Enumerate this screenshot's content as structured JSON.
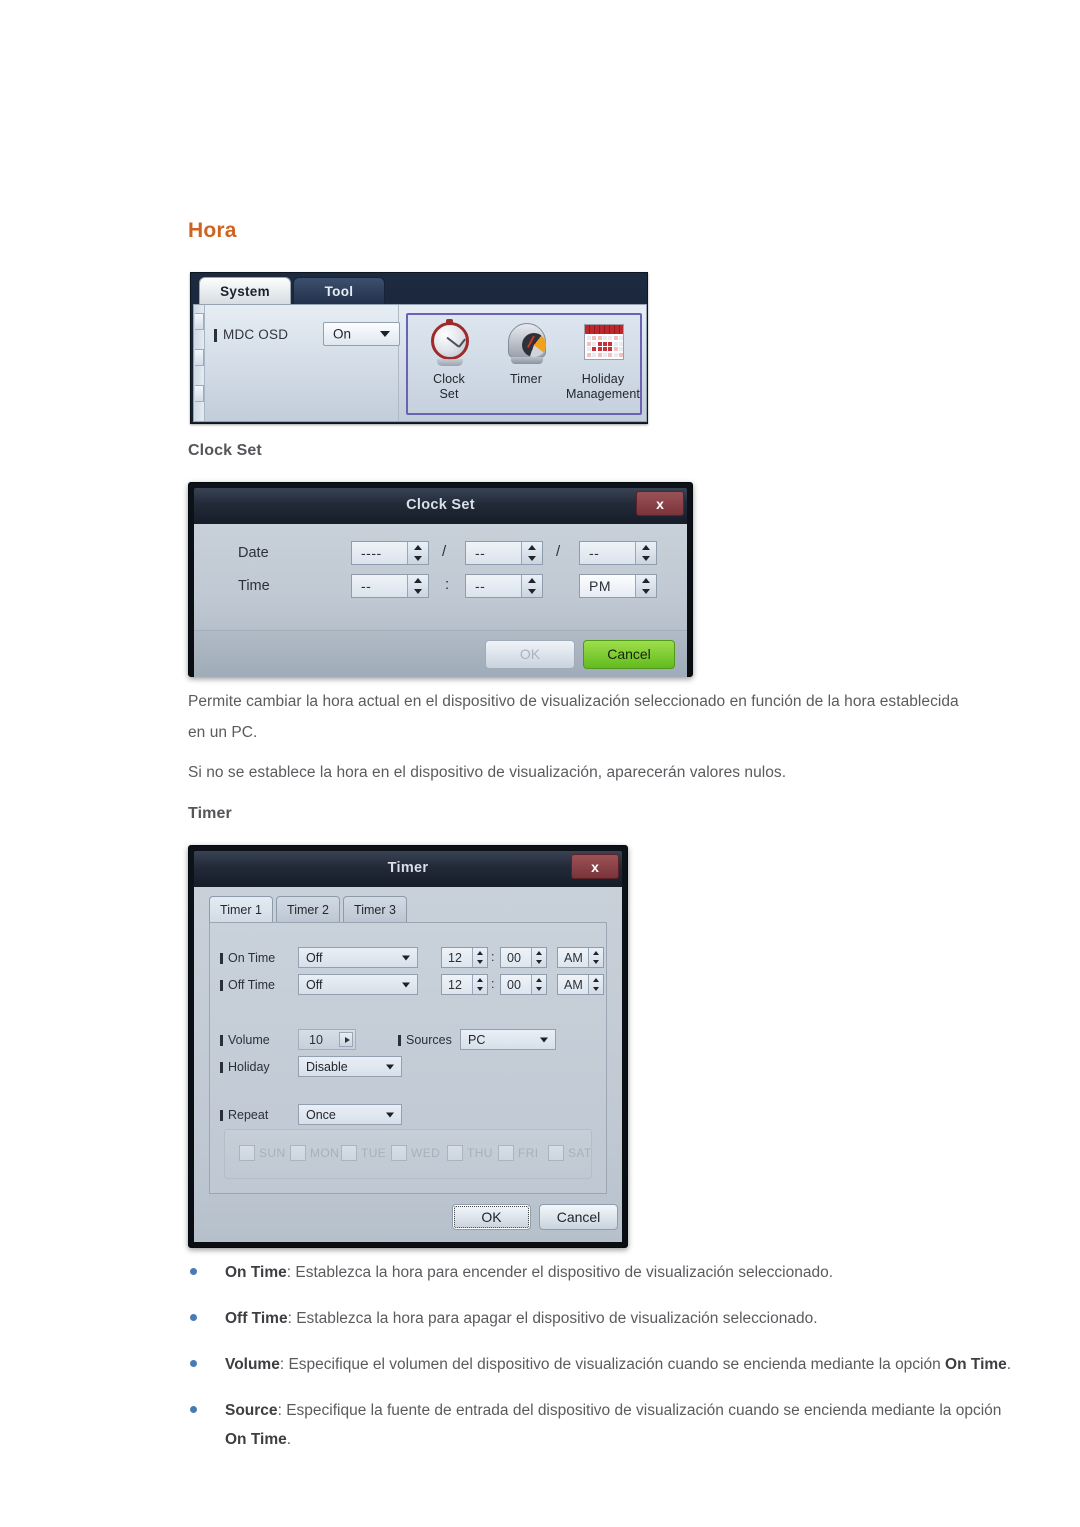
{
  "page": {
    "heading": "Hora",
    "subheading_clock": "Clock Set",
    "subheading_timer": "Timer",
    "paragraph_1": "Permite cambiar la hora actual en el dispositivo de visualización seleccionado en función de la hora establecida en un PC.",
    "paragraph_2": "Si no se establece la hora en el dispositivo de visualización, aparecerán valores nulos.",
    "heading_color": "#cf6420",
    "subheading_color": "#55565a",
    "bullet_color": "#4a7ab5"
  },
  "mdc_panel": {
    "tabs": [
      {
        "label": "System",
        "active": true
      },
      {
        "label": "Tool",
        "active": false
      }
    ],
    "osd": {
      "label": "MDC OSD",
      "value": "On"
    },
    "icons": [
      {
        "name": "clock-set-icon",
        "line1": "Clock",
        "line2": "Set"
      },
      {
        "name": "timer-icon",
        "line1": "Timer",
        "line2": ""
      },
      {
        "name": "holiday-management-icon",
        "line1": "Holiday",
        "line2": "Management"
      }
    ],
    "selection_border_color": "#6a63b4"
  },
  "clock_set_dialog": {
    "title": "Clock Set",
    "close_label": "x",
    "date_label": "Date",
    "time_label": "Time",
    "date": {
      "year": "----",
      "month": "--",
      "day": "--",
      "sep": "/"
    },
    "time": {
      "hour": "--",
      "minute": "--",
      "meridiem": "PM",
      "sep": ":"
    },
    "buttons": {
      "ok": "OK",
      "cancel": "Cancel",
      "ok_enabled": false,
      "cancel_color": "#79c42a"
    }
  },
  "timer_dialog": {
    "title": "Timer",
    "close_label": "x",
    "tabs": [
      {
        "label": "Timer 1",
        "active": true
      },
      {
        "label": "Timer 2",
        "active": false
      },
      {
        "label": "Timer 3",
        "active": false
      }
    ],
    "rows": {
      "on_time": {
        "label": "On Time",
        "mode": "Off",
        "hour": "12",
        "minute": "00",
        "meridiem": "AM"
      },
      "off_time": {
        "label": "Off Time",
        "mode": "Off",
        "hour": "12",
        "minute": "00",
        "meridiem": "AM"
      },
      "volume": {
        "label": "Volume",
        "value": "10"
      },
      "sources": {
        "label": "Sources",
        "value": "PC"
      },
      "holiday": {
        "label": "Holiday",
        "value": "Disable"
      },
      "repeat": {
        "label": "Repeat",
        "value": "Once"
      }
    },
    "days": [
      {
        "label": "SUN",
        "checked": false
      },
      {
        "label": "MON",
        "checked": false
      },
      {
        "label": "TUE",
        "checked": false
      },
      {
        "label": "WED",
        "checked": false
      },
      {
        "label": "THU",
        "checked": false
      },
      {
        "label": "FRI",
        "checked": false
      },
      {
        "label": "SAT",
        "checked": false
      }
    ],
    "days_enabled": false,
    "buttons": {
      "ok": "OK",
      "cancel": "Cancel"
    }
  },
  "bullets": [
    {
      "term": "On Time",
      "sep": ": ",
      "text": "Establezca la hora para encender el dispositivo de visualización seleccionado."
    },
    {
      "term": "Off Time",
      "sep": ": ",
      "text": "Establezca la hora para apagar el dispositivo de visualización seleccionado."
    },
    {
      "term": "Volume",
      "sep": ": ",
      "text": "Especifique el volumen del dispositivo de visualización cuando se encienda mediante la opción ",
      "term2": "On Time",
      "tail": "."
    },
    {
      "term": "Source",
      "sep": ": ",
      "text": "Especifique la fuente de entrada del dispositivo de visualización cuando se encienda mediante la opción ",
      "term2": "On Time",
      "tail": "."
    }
  ]
}
